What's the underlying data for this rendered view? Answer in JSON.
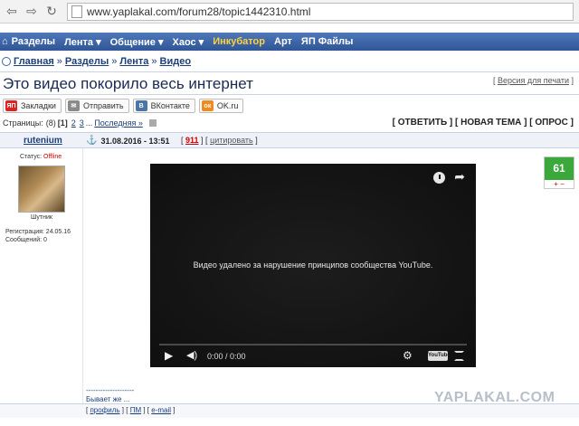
{
  "browser": {
    "url": "www.yaplakal.com/forum28/topic1442310.html"
  },
  "site_nav": {
    "items": [
      {
        "label": "Разделы",
        "highlight": false
      },
      {
        "label": "Лента ▾",
        "highlight": false
      },
      {
        "label": "Общение ▾",
        "highlight": false
      },
      {
        "label": "Хаос ▾",
        "highlight": false
      },
      {
        "label": "Инкубатор",
        "highlight": true
      },
      {
        "label": "Арт",
        "highlight": false
      },
      {
        "label": "ЯП Файлы",
        "highlight": false
      }
    ]
  },
  "breadcrumb": [
    "Главная",
    "Разделы",
    "Лента",
    "Видео"
  ],
  "topic": {
    "title": "Это видео покорило весь интернет",
    "print_link": "Версия для печати"
  },
  "share_buttons": [
    {
      "icon": "ЯП",
      "label": "Закладки",
      "color": "#d22"
    },
    {
      "icon": "✉",
      "label": "Отправить",
      "color": "#8a8a8a"
    },
    {
      "icon": "В",
      "label": "ВКонтакте",
      "color": "#4a76a8"
    },
    {
      "icon": "ок",
      "label": "OK.ru",
      "color": "#f2891d"
    }
  ],
  "pages": {
    "label": "Страницы:",
    "total": "(8)",
    "current": "[1]",
    "links": [
      "2",
      "3"
    ],
    "ellipsis": "...",
    "last": "Последняя »"
  },
  "actions": "[ ОТВЕТИТЬ ] [ НОВАЯ ТЕМА ] [ ОПРОС ]",
  "post": {
    "author": "rutenium",
    "date": "31.08.2016 - 13:51",
    "number": "911",
    "quote_label": "цитировать",
    "status_label": "Статус:",
    "status_value": "Offline",
    "avatar_caption": "Шутник",
    "registration": "Регистрация: 24.05.16",
    "messages": "Сообщений: 0",
    "rating": "61",
    "rating_controls": "+ −",
    "signature_line": "--------------------",
    "signature": "Бывает же ...",
    "footer_links": [
      "профиль",
      "ПМ",
      "e-mail"
    ]
  },
  "video": {
    "message": "Видео удалено за нарушение принципов сообщества YouTube.",
    "time": "0:00 / 0:00",
    "logo": "YouTube"
  },
  "watermark": "YAPLAKAL.COM"
}
